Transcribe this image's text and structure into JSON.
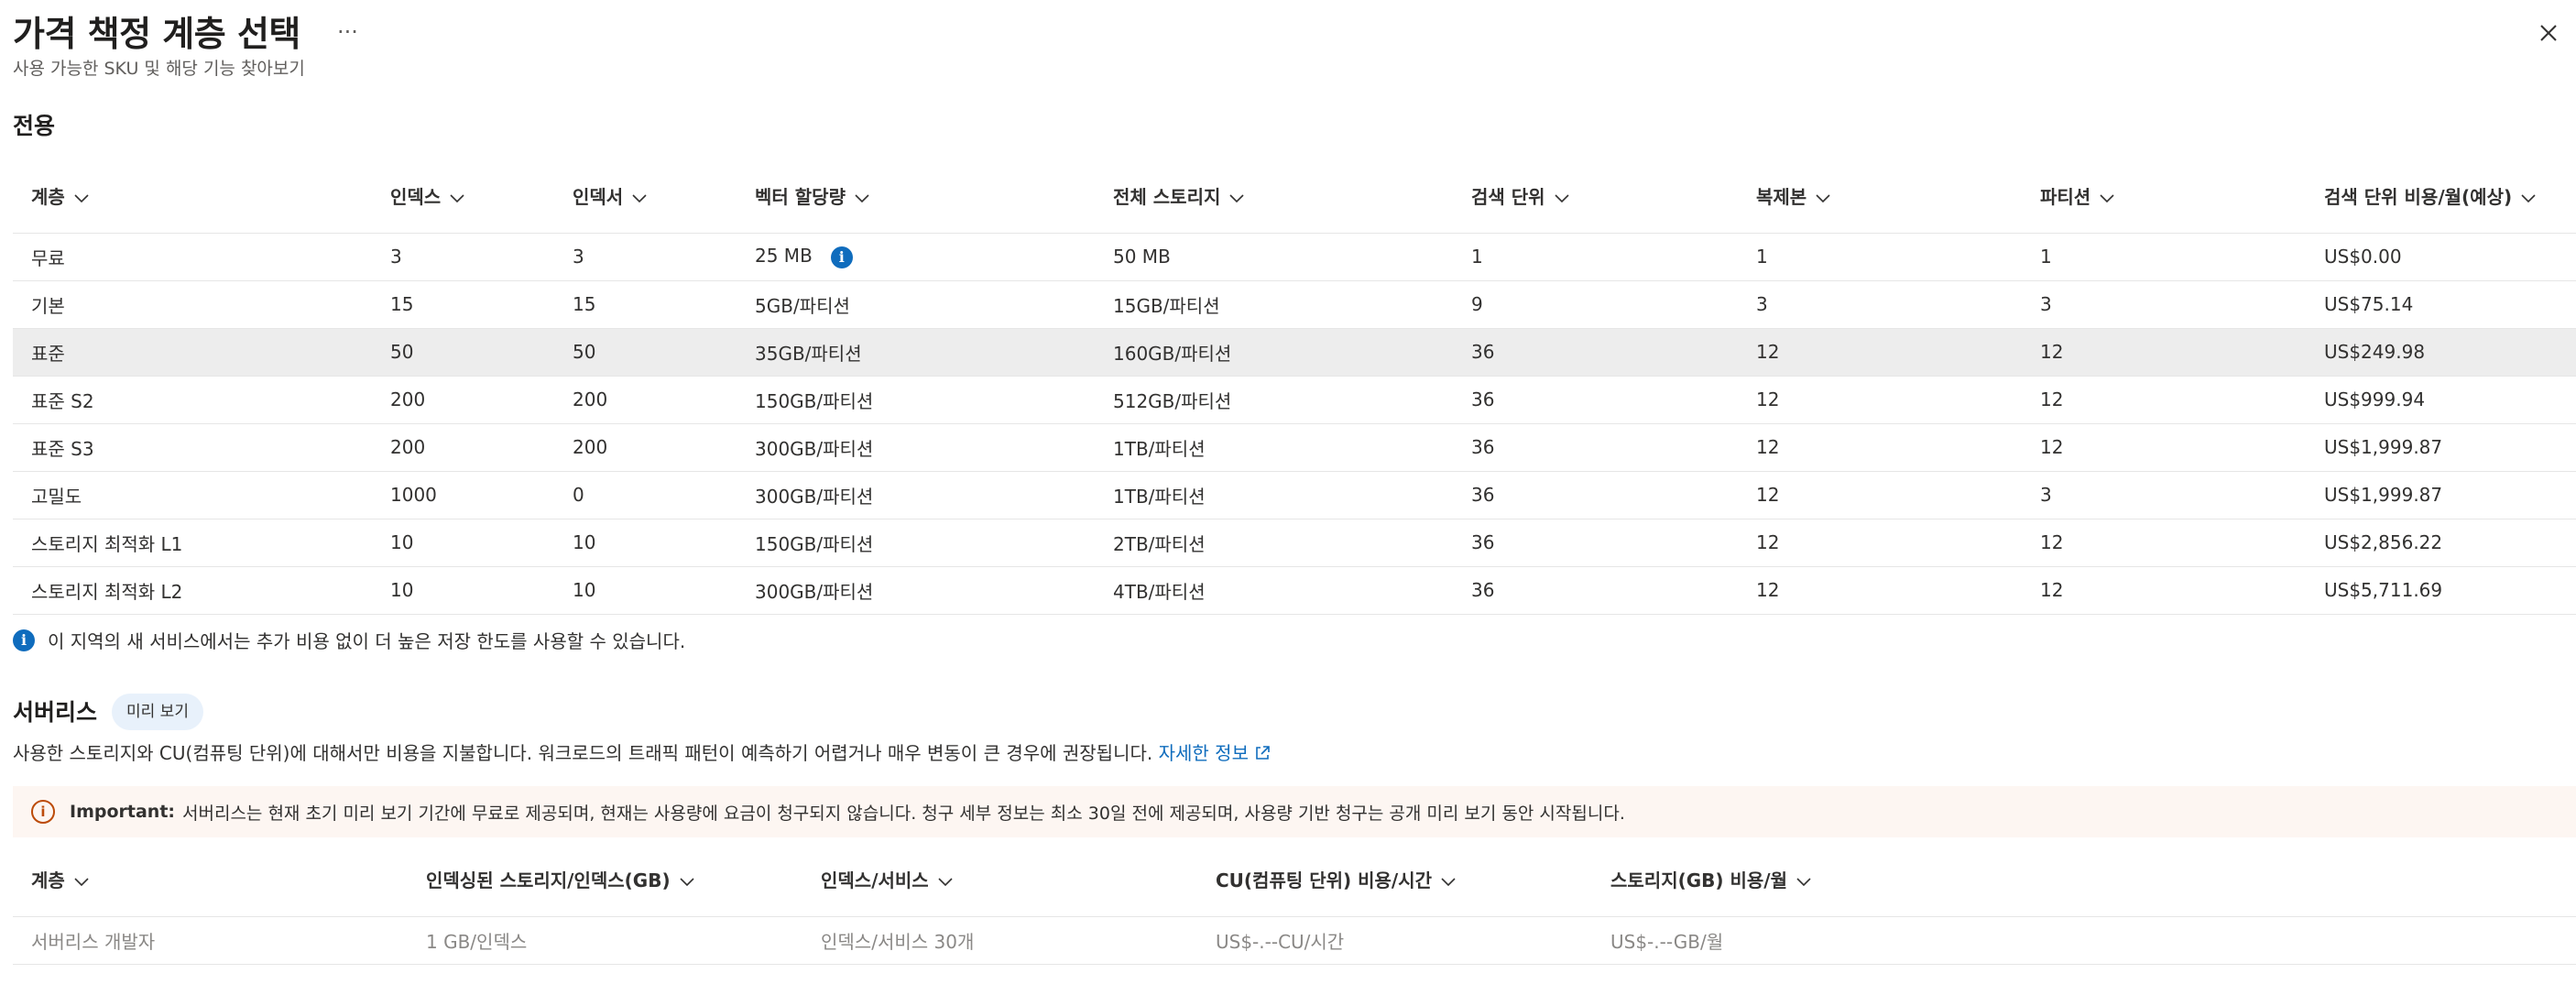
{
  "header": {
    "title": "가격 책정 계층 선택",
    "more_label": "...",
    "subtitle": "사용 가능한 SKU 및 해당 기능 찾아보기"
  },
  "dedicated": {
    "title": "전용",
    "columns": [
      "계층",
      "인덱스",
      "인덱서",
      "벡터 할당량",
      "전체 스토리지",
      "검색 단위",
      "복제본",
      "파티션",
      "검색 단위 비용/월(예상)"
    ],
    "rows": [
      {
        "tier": "무료",
        "indexes": "3",
        "indexers": "3",
        "vector": "25 MB",
        "storage": "50 MB",
        "units": "1",
        "replicas": "1",
        "partitions": "1",
        "cost": "US$0.00"
      },
      {
        "tier": "기본",
        "indexes": "15",
        "indexers": "15",
        "vector": "5GB/파티션",
        "storage": "15GB/파티션",
        "units": "9",
        "replicas": "3",
        "partitions": "3",
        "cost": "US$75.14"
      },
      {
        "tier": "표준",
        "indexes": "50",
        "indexers": "50",
        "vector": "35GB/파티션",
        "storage": "160GB/파티션",
        "units": "36",
        "replicas": "12",
        "partitions": "12",
        "cost": "US$249.98"
      },
      {
        "tier": "표준 S2",
        "indexes": "200",
        "indexers": "200",
        "vector": "150GB/파티션",
        "storage": "512GB/파티션",
        "units": "36",
        "replicas": "12",
        "partitions": "12",
        "cost": "US$999.94"
      },
      {
        "tier": "표준 S3",
        "indexes": "200",
        "indexers": "200",
        "vector": "300GB/파티션",
        "storage": "1TB/파티션",
        "units": "36",
        "replicas": "12",
        "partitions": "12",
        "cost": "US$1,999.87"
      },
      {
        "tier": "고밀도",
        "indexes": "1000",
        "indexers": "0",
        "vector": "300GB/파티션",
        "storage": "1TB/파티션",
        "units": "36",
        "replicas": "12",
        "partitions": "3",
        "cost": "US$1,999.87"
      },
      {
        "tier": "스토리지 최적화 L1",
        "indexes": "10",
        "indexers": "10",
        "vector": "150GB/파티션",
        "storage": "2TB/파티션",
        "units": "36",
        "replicas": "12",
        "partitions": "12",
        "cost": "US$2,856.22"
      },
      {
        "tier": "스토리지 최적화 L2",
        "indexes": "10",
        "indexers": "10",
        "vector": "300GB/파티션",
        "storage": "4TB/파티션",
        "units": "36",
        "replicas": "12",
        "partitions": "12",
        "cost": "US$5,711.69"
      }
    ],
    "note": "이 지역의 새 서비스에서는 추가 비용 없이 더 높은 저장 한도를 사용할 수 있습니다."
  },
  "serverless": {
    "title": "서버리스",
    "badge": "미리 보기",
    "description": "사용한 스토리지와 CU(컴퓨팅 단위)에 대해서만 비용을 지불합니다. 워크로드의 트래픽 패턴이 예측하기 어렵거나 매우 변동이 큰 경우에 권장됩니다.",
    "learn_more": "자세한 정보",
    "banner_label": "Important:",
    "banner_text": "서버리스는 현재 초기 미리 보기 기간에 무료로 제공되며, 현재는 사용량에 요금이 청구되지 않습니다. 청구 세부 정보는 최소 30일 전에 제공되며, 사용량 기반 청구는 공개 미리 보기 동안 시작됩니다.",
    "columns": [
      "계층",
      "인덱싱된 스토리지/인덱스(GB)",
      "인덱스/서비스",
      "CU(컴퓨팅 단위) 비용/시간",
      "스토리지(GB) 비용/월"
    ],
    "rows": [
      {
        "tier": "서버리스 개발자",
        "storage": "1 GB/인덱스",
        "indexes": "인덱스/서비스 30개",
        "cu_cost": "US$-.--CU/시간",
        "storage_cost": "US$-.--GB/월"
      }
    ]
  },
  "colors": {
    "accent": "#0f6cbd",
    "selected_row": "#ededed",
    "banner_bg": "#fdf6f2",
    "warning": "#bc4b09"
  }
}
